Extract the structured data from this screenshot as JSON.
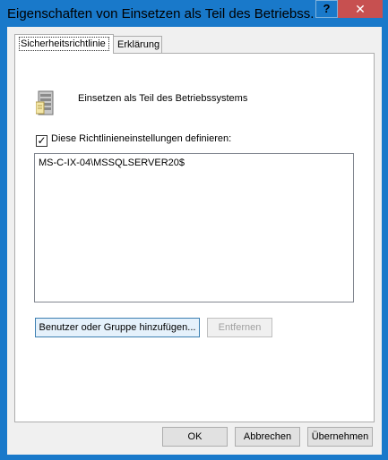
{
  "window": {
    "title": "Eigenschaften von Einsetzen als Teil des Betriebss...",
    "help_glyph": "?",
    "close_glyph": "✕"
  },
  "tabs": [
    {
      "label": "Sicherheitsrichtlinie",
      "active": true
    },
    {
      "label": "Erklärung",
      "active": false
    }
  ],
  "policy": {
    "icon": "server-icon",
    "name": "Einsetzen als Teil des Betriebssystems",
    "define_checkbox_label": "Diese Richtlinieneinstellungen definieren:",
    "define_checked": true,
    "checkmark": "✓"
  },
  "accounts": [
    "MS-C-IX-04\\MSSQLSERVER20$"
  ],
  "buttons": {
    "add": "Benutzer oder Gruppe hinzufügen...",
    "remove": "Entfernen",
    "ok": "OK",
    "cancel": "Abbrechen",
    "apply": "Übernehmen"
  },
  "colors": {
    "titlebar": "#1979ca",
    "close": "#c75050"
  }
}
